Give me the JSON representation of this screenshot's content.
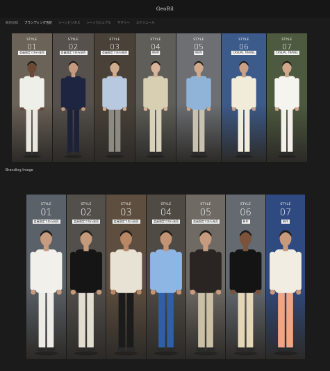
{
  "header": {
    "logo": "GeoBil"
  },
  "nav": {
    "items": [
      {
        "label": "最新投稿",
        "active": false
      },
      {
        "label": "ブランディング合計",
        "active": true
      },
      {
        "label": "シーンビジネス",
        "active": false
      },
      {
        "label": "シーンカジュアル",
        "active": false
      },
      {
        "label": "サマリー",
        "active": false
      },
      {
        "label": "スケジュール",
        "active": false
      }
    ]
  },
  "gallery1": {
    "style_word": "STYLE",
    "panels": [
      {
        "num": "01",
        "caption": "会員限定で先行発売",
        "bg": "#6b6258",
        "shirt": "#efefea",
        "pants": "#e9e7e0",
        "skin": "#6a4a36"
      },
      {
        "num": "02",
        "caption": "会員限定で先行発売",
        "bg": "#56514c",
        "shirt": "#1e2540",
        "pants": "#1c2238",
        "skin": "#c39a7e"
      },
      {
        "num": "03",
        "caption": "会員限定で先行発売",
        "bg": "#4a4239",
        "shirt": "#b7c8df",
        "pants": "#8d8a84",
        "skin": "#d1ab8e"
      },
      {
        "num": "04",
        "caption": "NEW",
        "bg": "#5f5e58",
        "shirt": "#d8cfb3",
        "pants": "#d9d2bb",
        "skin": "#d8b49a"
      },
      {
        "num": "05",
        "caption": "NEW",
        "bg": "#6d6f73",
        "shirt": "#8fb4d8",
        "pants": "#c8c1b2",
        "skin": "#d0a98b"
      },
      {
        "num": "06",
        "caption": "CASUAL TRAVEL",
        "bg": "#3c5a8a",
        "shirt": "#f1ecd9",
        "pants": "#f1ecdb",
        "skin": "#c99f85"
      },
      {
        "num": "07",
        "caption": "CASUAL TRAVEL",
        "bg": "#4d5a3f",
        "shirt": "#f6f4ef",
        "pants": "#f3f0ea",
        "skin": "#d1a88c"
      }
    ]
  },
  "section2": {
    "title": "Branding Image"
  },
  "gallery2": {
    "style_word": "STYLE",
    "panels": [
      {
        "num": "01",
        "caption": "会員限定で先行発売",
        "bg": "#5b6168",
        "shirt": "#f2f0ea",
        "pants": "#ecebe5",
        "skin": "#c79b7d"
      },
      {
        "num": "02",
        "caption": "会員限定で先行発売",
        "bg": "#53504c",
        "shirt": "#151515",
        "pants": "#e2ddd1",
        "skin": "#c49a7b"
      },
      {
        "num": "03",
        "caption": "会員限定で先行発売",
        "bg": "#5e4e3f",
        "shirt": "#e8e2d4",
        "pants": "#1b1b1b",
        "skin": "#b88766"
      },
      {
        "num": "04",
        "caption": "会員限定で先行発売",
        "bg": "#4f4a44",
        "shirt": "#8eb6e4",
        "pants": "#2f5fa8",
        "skin": "#c39474"
      },
      {
        "num": "05",
        "caption": "会員限定で先行発売",
        "bg": "#6f6a64",
        "shirt": "#2a2522",
        "pants": "#cbbfa6",
        "skin": "#c79c7e"
      },
      {
        "num": "06",
        "caption": "新作",
        "bg": "#646a70",
        "shirt": "#141414",
        "pants": "#e5d7b6",
        "skin": "#7b533b"
      },
      {
        "num": "07",
        "caption": "新作",
        "bg": "#2e4a80",
        "shirt": "#f1ede3",
        "pants": "#f0a585",
        "skin": "#c79a7b"
      }
    ]
  }
}
